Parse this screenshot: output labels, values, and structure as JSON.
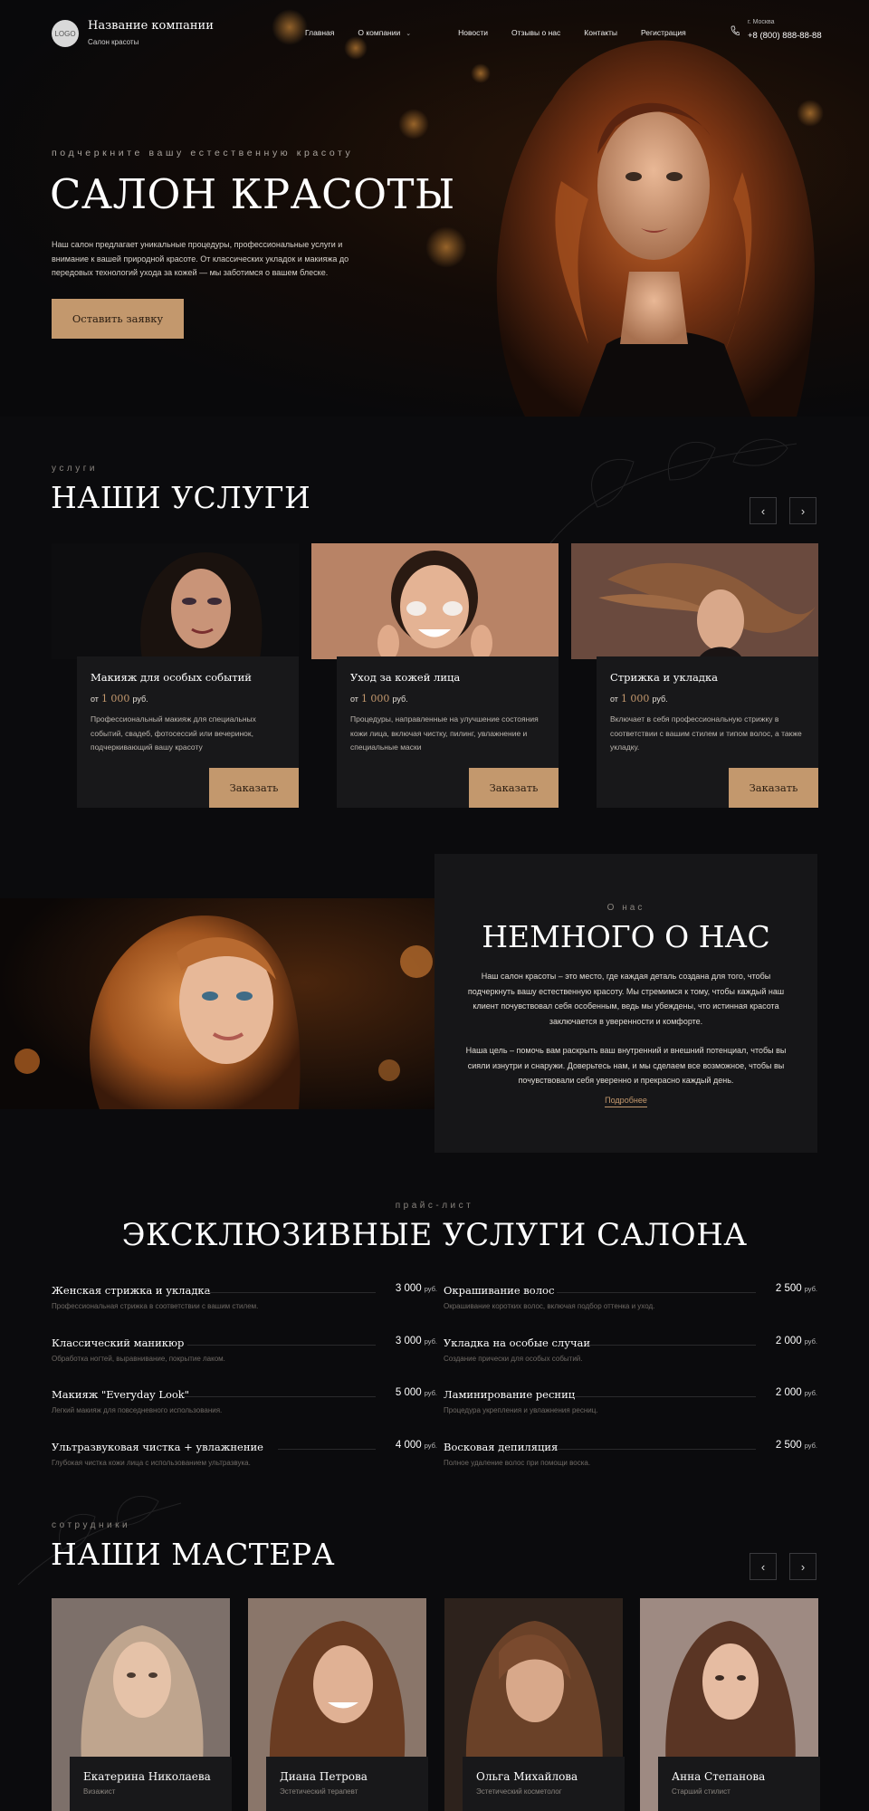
{
  "header": {
    "logo_text": "LOGO",
    "company_name": "Название компании",
    "company_sub": "Салон красоты",
    "nav": [
      "Главная",
      "О компании",
      "Новости",
      "Отзывы о нас",
      "Контакты",
      "Регистрация"
    ],
    "city": "г. Москва",
    "phone": "+8 (800) 888-88-88"
  },
  "hero": {
    "tagline": "подчеркните вашу естественную красоту",
    "title": "САЛОН КРАСОТЫ",
    "text": "Наш салон предлагает уникальные процедуры, профессиональные услуги и внимание к вашей природной красоте. От классических укладок и макияжа до передовых технологий ухода за кожей — мы заботимся о вашем блеске.",
    "button": "Оставить заявку"
  },
  "services": {
    "tag": "услуги",
    "title": "НАШИ УСЛУГИ",
    "prev_icon": "chevron-left-icon",
    "next_icon": "chevron-right-icon",
    "items": [
      {
        "name": "Макияж для особых событий",
        "price_prefix": "от",
        "price": "1 000",
        "currency": "руб.",
        "description": "Профессиональный макияж для специальных событий, свадеб, фотосессий или вечеринок, подчеркивающий вашу красоту",
        "button": "Заказать"
      },
      {
        "name": "Уход за кожей лица",
        "price_prefix": "от",
        "price": "1 000",
        "currency": "руб.",
        "description": "Процедуры, направленные на улучшение состояния кожи лица, включая чистку, пилинг, увлажнение и специальные маски",
        "button": "Заказать"
      },
      {
        "name": "Стрижка и укладка",
        "price_prefix": "от",
        "price": "1 000",
        "currency": "руб.",
        "description": "Включает в себя профессиональную стрижку в соответствии с вашим стилем и типом волос, а также укладку.",
        "button": "Заказать"
      }
    ]
  },
  "about": {
    "tag": "О нас",
    "title": "НЕМНОГО О НАС",
    "paragraph1": "Наш салон красоты – это место, где каждая деталь создана для того, чтобы подчеркнуть вашу естественную красоту. Мы стремимся к тому, чтобы каждый наш клиент почувствовал себя особенным, ведь мы убеждены, что истинная красота заключается в уверенности и комфорте.",
    "paragraph2": "Наша цель – помочь вам раскрыть ваш внутренний и внешний потенциал, чтобы вы сияли изнутри и снаружи. Доверьтесь нам, и мы сделаем все возможное, чтобы вы почувствовали себя уверенно и прекрасно каждый день.",
    "link": "Подробнее"
  },
  "pricelist": {
    "tag": "прайс-лист",
    "title": "ЭКСКЛЮЗИВНЫЕ УСЛУГИ САЛОНА",
    "currency": "руб.",
    "left": [
      {
        "name": "Женская стрижка и укладка",
        "price": "3 000",
        "desc": "Профессиональная стрижка в соответствии с вашим стилем."
      },
      {
        "name": "Классический маникюр",
        "price": "3 000",
        "desc": "Обработка ногтей, выравнивание, покрытие лаком."
      },
      {
        "name": "Макияж \"Everyday Look\"",
        "price": "5 000",
        "desc": "Легкий макияж для повседневного использования."
      },
      {
        "name": "Ультразвуковая чистка + увлажнение",
        "price": "4 000",
        "desc": "Глубокая чистка кожи лица с использованием ультразвука."
      }
    ],
    "right": [
      {
        "name": "Окрашивание волос",
        "price": "2 500",
        "desc": "Окрашивание коротких волос, включая подбор оттенка и уход."
      },
      {
        "name": "Укладка на особые случаи",
        "price": "2 000",
        "desc": "Создание прически для особых событий."
      },
      {
        "name": "Ламинирование ресниц",
        "price": "2 000",
        "desc": "Процедура укрепления и увлажнения ресниц."
      },
      {
        "name": "Восковая депиляция",
        "price": "2 500",
        "desc": "Полное удаление волос при помощи воска."
      }
    ]
  },
  "masters": {
    "tag": "сотрудники",
    "title": "НАШИ МАСТЕРА",
    "items": [
      {
        "name": "Екатерина Николаева",
        "role": "Визажист"
      },
      {
        "name": "Диана Петрова",
        "role": "Эстетический терапевт"
      },
      {
        "name": "Ольга Михайлова",
        "role": "Эстетический косметолог"
      },
      {
        "name": "Анна Степанова",
        "role": "Старший стилист"
      }
    ]
  },
  "colors": {
    "background": "#0b0b0d",
    "accent_gold": "#c3986d",
    "card": "#18181a"
  }
}
